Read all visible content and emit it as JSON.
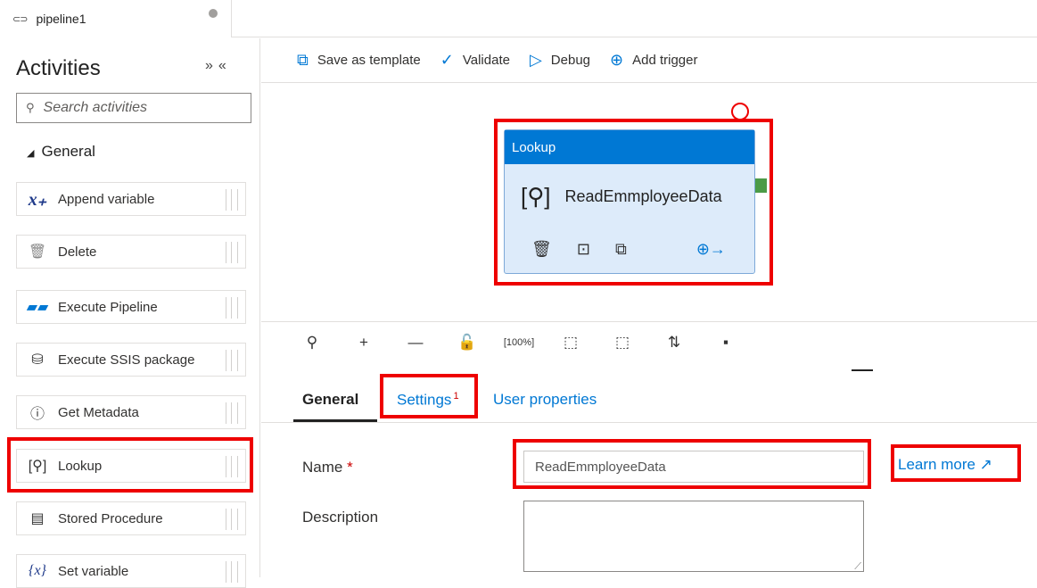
{
  "tab": {
    "title": "pipeline1"
  },
  "sidebar": {
    "title": "Activities",
    "search_placeholder": "Search activities",
    "group": "General",
    "items": [
      {
        "label": "Append variable",
        "icon": "append-variable-icon"
      },
      {
        "label": "Delete",
        "icon": "trash-icon"
      },
      {
        "label": "Execute Pipeline",
        "icon": "execute-pipeline-icon"
      },
      {
        "label": "Execute SSIS package",
        "icon": "ssis-icon"
      },
      {
        "label": "Get Metadata",
        "icon": "info-icon"
      },
      {
        "label": "Lookup",
        "icon": "lookup-icon"
      },
      {
        "label": "Stored Procedure",
        "icon": "stored-procedure-icon"
      },
      {
        "label": "Set variable",
        "icon": "set-variable-icon"
      }
    ]
  },
  "toolbar": {
    "save_template": "Save as template",
    "validate": "Validate",
    "debug": "Debug",
    "add_trigger": "Add trigger"
  },
  "node": {
    "type": "Lookup",
    "name": "ReadEmmployeeData"
  },
  "properties": {
    "tabs": {
      "general": "General",
      "settings": "Settings",
      "settings_badge": "1",
      "user_properties": "User properties"
    },
    "name_label": "Name",
    "name_required": "*",
    "name_value": "ReadEmmployeeData",
    "learn_more": "Learn more",
    "description_label": "Description"
  },
  "colors": {
    "accent": "#0078d4",
    "highlight": "#e00000",
    "port": "#4c9b47"
  }
}
